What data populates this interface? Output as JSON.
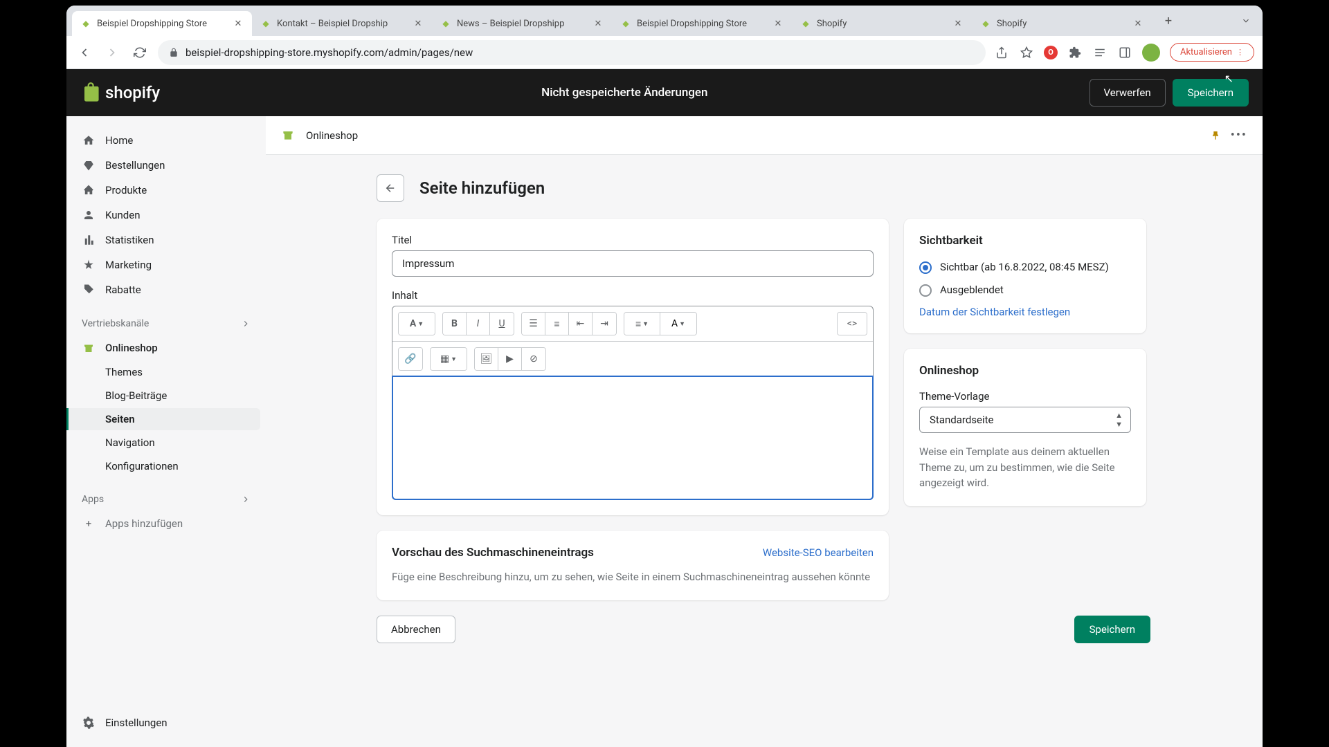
{
  "browser": {
    "tabs": [
      {
        "title": "Beispiel Dropshipping Store",
        "active": true
      },
      {
        "title": "Kontakt – Beispiel Dropship",
        "active": false
      },
      {
        "title": "News – Beispiel Dropshipp",
        "active": false
      },
      {
        "title": "Beispiel Dropshipping Store",
        "active": false
      },
      {
        "title": "Shopify",
        "active": false
      },
      {
        "title": "Shopify",
        "active": false
      }
    ],
    "url": "beispiel-dropshipping-store.myshopify.com/admin/pages/new",
    "update_label": "Aktualisieren"
  },
  "topbar": {
    "brand": "shopify",
    "unsaved": "Nicht gespeicherte Änderungen",
    "discard": "Verwerfen",
    "save": "Speichern"
  },
  "sidebar": {
    "items": [
      {
        "label": "Home"
      },
      {
        "label": "Bestellungen"
      },
      {
        "label": "Produkte"
      },
      {
        "label": "Kunden"
      },
      {
        "label": "Statistiken"
      },
      {
        "label": "Marketing"
      },
      {
        "label": "Rabatte"
      }
    ],
    "channels_heading": "Vertriebskanäle",
    "onlineshop_label": "Onlineshop",
    "onlineshop_subs": [
      {
        "label": "Themes"
      },
      {
        "label": "Blog-Beiträge"
      },
      {
        "label": "Seiten",
        "active": true
      },
      {
        "label": "Navigation"
      },
      {
        "label": "Konfigurationen"
      }
    ],
    "apps_heading": "Apps",
    "add_apps": "Apps hinzufügen",
    "settings": "Einstellungen"
  },
  "breadcrumb": {
    "text": "Onlineshop"
  },
  "page": {
    "title": "Seite hinzufügen",
    "title_label": "Titel",
    "title_value": "Impressum",
    "content_label": "Inhalt",
    "seo_heading": "Vorschau des Suchmaschineneintrags",
    "seo_edit": "Website-SEO bearbeiten",
    "seo_desc": "Füge eine Beschreibung hinzu, um zu sehen, wie Seite in einem Suchmaschineneintrag aussehen könnte"
  },
  "visibility": {
    "heading": "Sichtbarkeit",
    "visible_label": "Sichtbar (ab 16.8.2022, 08:45 MESZ)",
    "hidden_label": "Ausgeblendet",
    "set_date": "Datum der Sichtbarkeit festlegen"
  },
  "onlineshop_card": {
    "heading": "Onlineshop",
    "template_label": "Theme-Vorlage",
    "template_value": "Standardseite",
    "help": "Weise ein Template aus deinem aktuellen Theme zu, um zu bestimmen, wie die Seite angezeigt wird."
  },
  "actions": {
    "cancel": "Abbrechen",
    "save": "Speichern"
  }
}
